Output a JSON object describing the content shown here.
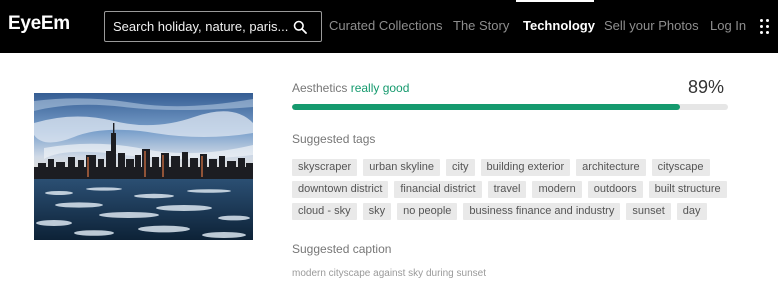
{
  "header": {
    "logo": "EyeEm",
    "search": {
      "placeholder": "Search holiday, nature, paris..."
    },
    "nav": {
      "curated": "Curated Collections",
      "story": "The Story",
      "technology": "Technology",
      "sell": "Sell your Photos",
      "login": "Log In"
    },
    "active_nav": "Technology",
    "icons": {
      "search": "search-icon",
      "menu": "more-vertical-dots-icon"
    }
  },
  "photo": {
    "subject": "city skyline with skyscrapers over icy water"
  },
  "aesthetics": {
    "label": "Aesthetics",
    "rating": "really good",
    "score_text": "89%",
    "score_value": 0.89
  },
  "suggested_tags": {
    "title": "Suggested tags",
    "tags": [
      "skyscraper",
      "urban skyline",
      "city",
      "building exterior",
      "architecture",
      "cityscape",
      "downtown district",
      "financial district",
      "travel",
      "modern",
      "outdoors",
      "built structure",
      "cloud - sky",
      "sky",
      "no people",
      "business finance and industry",
      "sunset",
      "day"
    ]
  },
  "suggested_caption": {
    "title": "Suggested caption",
    "text": "modern cityscape against sky during sunset"
  },
  "colors": {
    "accent": "#159a6e",
    "header_bg": "#000000",
    "tag_bg": "#e9e9e9"
  }
}
